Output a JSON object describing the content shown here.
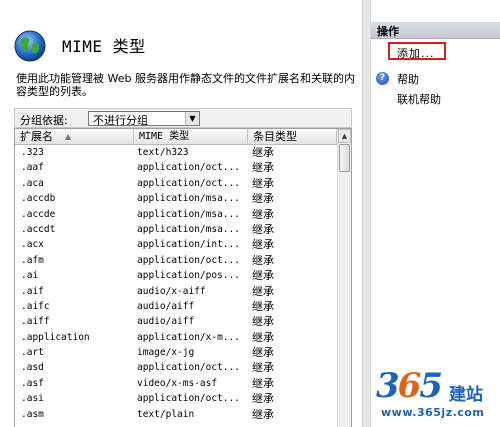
{
  "feature": {
    "title": "MIME 类型",
    "description": "使用此功能管理被 Web 服务器用作静态文件的文件扩展名和关联的内容类型的列表。"
  },
  "grouping": {
    "label": "分组依据:",
    "selected": "不进行分组"
  },
  "table": {
    "columns": [
      "扩展名",
      "MIME 类型",
      "条目类型"
    ],
    "rows": [
      {
        "ext": ".323",
        "mime": "text/h323",
        "type": "继承"
      },
      {
        "ext": ".aaf",
        "mime": "application/oct...",
        "type": "继承"
      },
      {
        "ext": ".aca",
        "mime": "application/oct...",
        "type": "继承"
      },
      {
        "ext": ".accdb",
        "mime": "application/msa...",
        "type": "继承"
      },
      {
        "ext": ".accde",
        "mime": "application/msa...",
        "type": "继承"
      },
      {
        "ext": ".accdt",
        "mime": "application/msa...",
        "type": "继承"
      },
      {
        "ext": ".acx",
        "mime": "application/int...",
        "type": "继承"
      },
      {
        "ext": ".afm",
        "mime": "application/oct...",
        "type": "继承"
      },
      {
        "ext": ".ai",
        "mime": "application/pos...",
        "type": "继承"
      },
      {
        "ext": ".aif",
        "mime": "audio/x-aiff",
        "type": "继承"
      },
      {
        "ext": ".aifc",
        "mime": "audio/aiff",
        "type": "继承"
      },
      {
        "ext": ".aiff",
        "mime": "audio/aiff",
        "type": "继承"
      },
      {
        "ext": ".application",
        "mime": "application/x-m...",
        "type": "继承"
      },
      {
        "ext": ".art",
        "mime": "image/x-jg",
        "type": "继承"
      },
      {
        "ext": ".asd",
        "mime": "application/oct...",
        "type": "继承"
      },
      {
        "ext": ".asf",
        "mime": "video/x-ms-asf",
        "type": "继承"
      },
      {
        "ext": ".asi",
        "mime": "application/oct...",
        "type": "继承"
      },
      {
        "ext": ".asm",
        "mime": "text/plain",
        "type": "继承"
      }
    ]
  },
  "actions": {
    "header": "操作",
    "add": "添加...",
    "help": "帮助",
    "online_help": "联机帮助"
  },
  "watermark": {
    "logo": "365",
    "logo_text": "建站",
    "url": "www.365jz.com"
  },
  "colors": {
    "highlight_border": "#d11f1f",
    "watermark_blue": "#1e63b8",
    "watermark_orange": "#e2621a"
  }
}
